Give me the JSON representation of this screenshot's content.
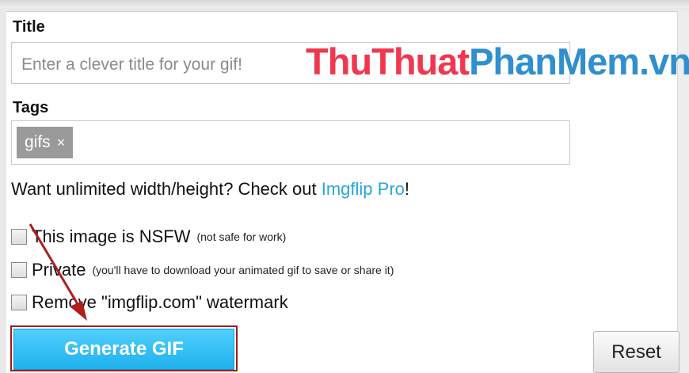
{
  "form": {
    "title_label": "Title",
    "title_placeholder": "Enter a clever title for your gif!",
    "tags_label": "Tags",
    "tag_chip": "gifs",
    "tag_remove": "×",
    "promo_text": "Want unlimited width/height? Check out ",
    "promo_link": "Imgflip Pro",
    "promo_suffix": "!",
    "options": [
      {
        "label": "This image is NSFW",
        "note": "(not safe for work)",
        "checked": false
      },
      {
        "label": "Private",
        "note": "(you'll have to download your animated gif to save or share it)",
        "checked": false
      },
      {
        "label": "Remove \"imgflip.com\" watermark",
        "note": "",
        "checked": false
      }
    ],
    "generate_label": "Generate GIF",
    "reset_label": "Reset"
  },
  "overlay": {
    "watermark_part1": "ThuThuat",
    "watermark_part2": "PhanMem.vn",
    "arrow_color": "#b01e1e"
  },
  "colors": {
    "button_blue": "#1fb0ec",
    "link_blue": "#2aa6d6",
    "highlight_border": "#9b1c1c"
  }
}
